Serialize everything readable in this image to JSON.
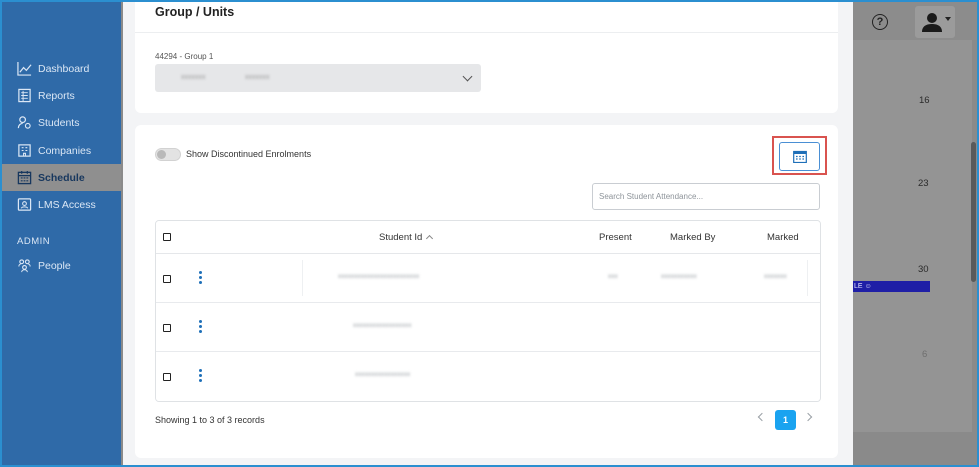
{
  "sidebar": {
    "items": [
      {
        "label": "Dashboard",
        "icon": "line-chart-icon"
      },
      {
        "label": "Reports",
        "icon": "report-icon"
      },
      {
        "label": "Students",
        "icon": "students-icon"
      },
      {
        "label": "Companies",
        "icon": "building-icon"
      },
      {
        "label": "Schedule",
        "icon": "calendar-icon",
        "active": true
      },
      {
        "label": "LMS Access",
        "icon": "lms-icon"
      }
    ],
    "section_admin": "ADMIN",
    "admin_items": [
      {
        "label": "People",
        "icon": "people-icon"
      }
    ]
  },
  "topbar": {
    "help_symbol": "?"
  },
  "background_calendar": {
    "day_numbers": [
      "16",
      "23",
      "30",
      "6"
    ],
    "event_label": "LE"
  },
  "group_card": {
    "title": "Group / Units",
    "group_label": "44294 - Group 1",
    "select_value_a": "xxxxxxx",
    "select_value_b": "xxxxxxx"
  },
  "attendance": {
    "toggle_label": "Show Discontinued Enrolments",
    "search_placeholder": "Search Student Attendance...",
    "columns": {
      "student_id": "Student Id",
      "present": "Present",
      "marked_by": "Marked By",
      "marked": "Marked"
    },
    "rows": [
      {
        "student": "xxxxxxxxxxxxxxxxxxxxxxxxx",
        "present": "xxx",
        "marked_by": "xxxxxxxxxxx",
        "marked": "xxxxxxx"
      },
      {
        "student": "xxxxxxxxxxxxxxxxxx",
        "present": "",
        "marked_by": "",
        "marked": ""
      },
      {
        "student": "xxxxxxxxxxxxxxxxx",
        "present": "",
        "marked_by": "",
        "marked": ""
      }
    ],
    "footer": "Showing 1 to 3 of 3 records",
    "current_page": "1"
  },
  "colors": {
    "sidebar_bg": "#2f6aa8",
    "accent_blue": "#1aa3f0",
    "highlight_red": "#d9534f"
  }
}
